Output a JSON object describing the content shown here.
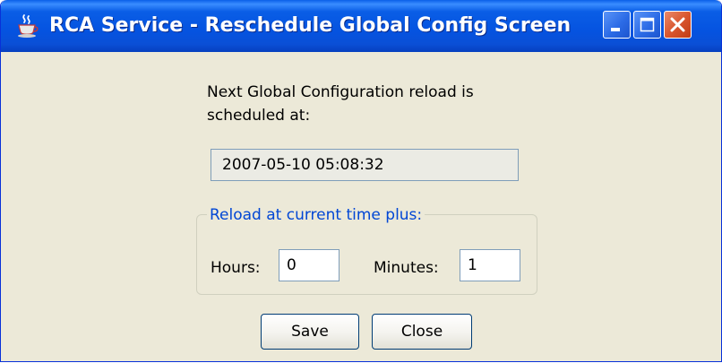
{
  "window": {
    "title": "RCA Service - Reschedule Global Config Screen",
    "app_icon": "java-coffee-cup-icon",
    "controls": {
      "minimize_icon": "minimize-icon",
      "maximize_icon": "maximize-icon",
      "close_icon": "close-icon"
    }
  },
  "info": {
    "line1": "Next Global Configuration reload is",
    "line2": "scheduled at:"
  },
  "scheduled_datetime": "2007-05-10 05:08:32",
  "reload_group": {
    "legend": "Reload at current time plus:",
    "hours_label": "Hours:",
    "hours_value": "0",
    "minutes_label": "Minutes:",
    "minutes_value": "1"
  },
  "buttons": {
    "save": "Save",
    "close": "Close"
  },
  "colors": {
    "titlebar": "#0553e0",
    "window_background": "#ece9d8",
    "group_legend": "#0046d5",
    "close_button": "#d9572f"
  }
}
